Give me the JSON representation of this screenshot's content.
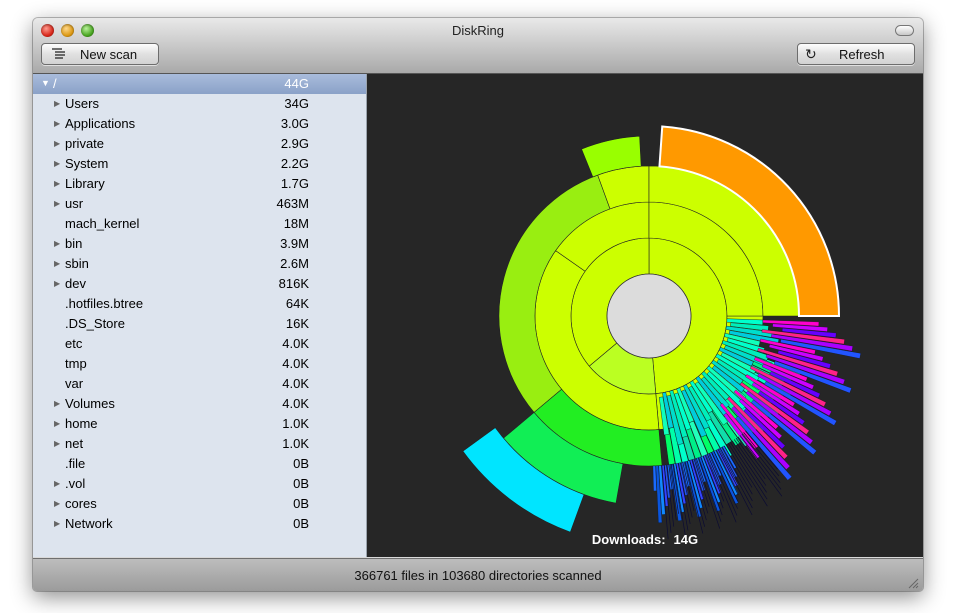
{
  "window": {
    "title": "DiskRing"
  },
  "toolbar": {
    "new_scan_label": "New scan",
    "new_scan_icon": "list-icon",
    "refresh_label": "Refresh",
    "refresh_icon": "refresh-icon"
  },
  "tree": {
    "root": {
      "name": "/",
      "size": "44G"
    },
    "items": [
      {
        "name": "Users",
        "size": "34G",
        "expandable": true
      },
      {
        "name": "Applications",
        "size": "3.0G",
        "expandable": true
      },
      {
        "name": "private",
        "size": "2.9G",
        "expandable": true
      },
      {
        "name": "System",
        "size": "2.2G",
        "expandable": true
      },
      {
        "name": "Library",
        "size": "1.7G",
        "expandable": true
      },
      {
        "name": "usr",
        "size": "463M",
        "expandable": true
      },
      {
        "name": "mach_kernel",
        "size": "18M",
        "expandable": false
      },
      {
        "name": "bin",
        "size": "3.9M",
        "expandable": true
      },
      {
        "name": "sbin",
        "size": "2.6M",
        "expandable": true
      },
      {
        "name": "dev",
        "size": "816K",
        "expandable": true
      },
      {
        "name": ".hotfiles.btree",
        "size": "64K",
        "expandable": false
      },
      {
        "name": ".DS_Store",
        "size": "16K",
        "expandable": false
      },
      {
        "name": "etc",
        "size": "4.0K",
        "expandable": false
      },
      {
        "name": "tmp",
        "size": "4.0K",
        "expandable": false
      },
      {
        "name": "var",
        "size": "4.0K",
        "expandable": false
      },
      {
        "name": "Volumes",
        "size": "4.0K",
        "expandable": true
      },
      {
        "name": "home",
        "size": "1.0K",
        "expandable": true
      },
      {
        "name": "net",
        "size": "1.0K",
        "expandable": true
      },
      {
        "name": ".file",
        "size": "0B",
        "expandable": false
      },
      {
        "name": ".vol",
        "size": "0B",
        "expandable": true
      },
      {
        "name": "cores",
        "size": "0B",
        "expandable": true
      },
      {
        "name": "Network",
        "size": "0B",
        "expandable": true
      }
    ]
  },
  "ring": {
    "hover_name": "Downloads:",
    "hover_size": "14G"
  },
  "status": {
    "text": "366761 files in 103680 directories scanned"
  },
  "colors": {
    "sidebar_bg": "#dde4ee",
    "selection": "#8aa1c8",
    "chart_bg": "#262626",
    "orange": "#ff9900",
    "yellow_green": "#ccff00",
    "lime": "#99ff00",
    "green": "#00ee44",
    "cyan": "#00e5ff",
    "teal": "#00ffaa",
    "blue": "#1a6bff",
    "magenta": "#ff00cc"
  }
}
